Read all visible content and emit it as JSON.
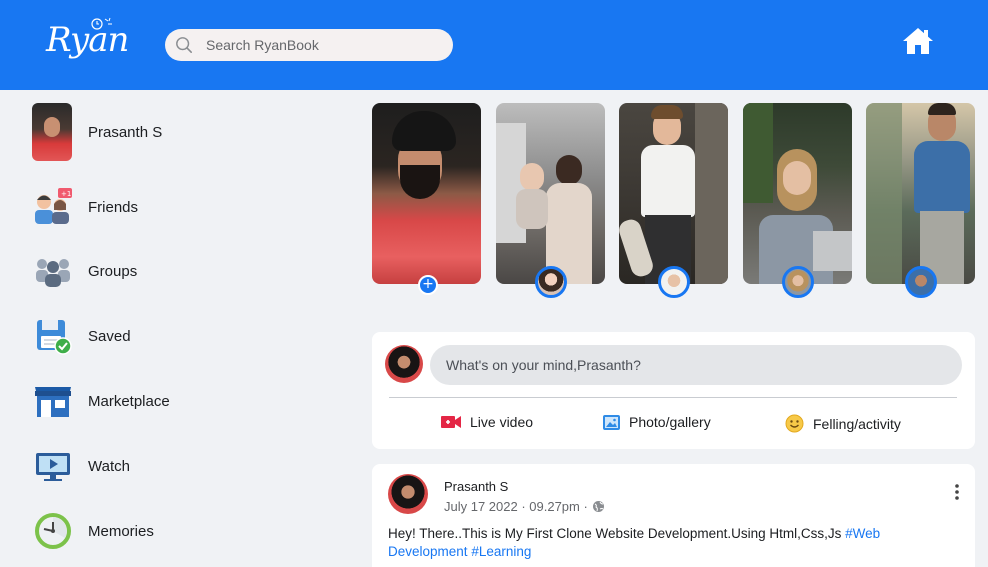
{
  "header": {
    "logo_text": "Ryan",
    "search_placeholder": "Search RyanBook",
    "accent_color": "#1877f2"
  },
  "sidebar": {
    "items": [
      {
        "label": "Prasanth S",
        "icon": "profile-avatar"
      },
      {
        "label": "Friends",
        "icon": "friends-icon",
        "badge": "+1"
      },
      {
        "label": "Groups",
        "icon": "groups-icon"
      },
      {
        "label": "Saved",
        "icon": "saved-icon"
      },
      {
        "label": "Marketplace",
        "icon": "marketplace-icon"
      },
      {
        "label": "Watch",
        "icon": "watch-icon"
      },
      {
        "label": "Memories",
        "icon": "memories-icon"
      }
    ]
  },
  "stories": [
    {
      "name": "own-story",
      "action": "+"
    },
    {
      "name": "story-2"
    },
    {
      "name": "story-3"
    },
    {
      "name": "story-4"
    },
    {
      "name": "story-5"
    }
  ],
  "composer": {
    "placeholder": "What's on your mind,Prasanth?",
    "actions": [
      {
        "label": "Live video",
        "icon": "video-icon",
        "color": "#e42645"
      },
      {
        "label": "Photo/gallery",
        "icon": "photo-icon",
        "color": "#1877f2"
      },
      {
        "label": "Felling/activity",
        "icon": "smiley-icon",
        "color": "#f7b928"
      }
    ]
  },
  "post": {
    "author": "Prasanth S",
    "meta": "July 17 2022 · 09.27pm ·",
    "text": "Hey! There..This is My First Clone Website Development.Using Html,Css,Js ",
    "tags": [
      "#Web Development",
      "#Learning"
    ]
  }
}
